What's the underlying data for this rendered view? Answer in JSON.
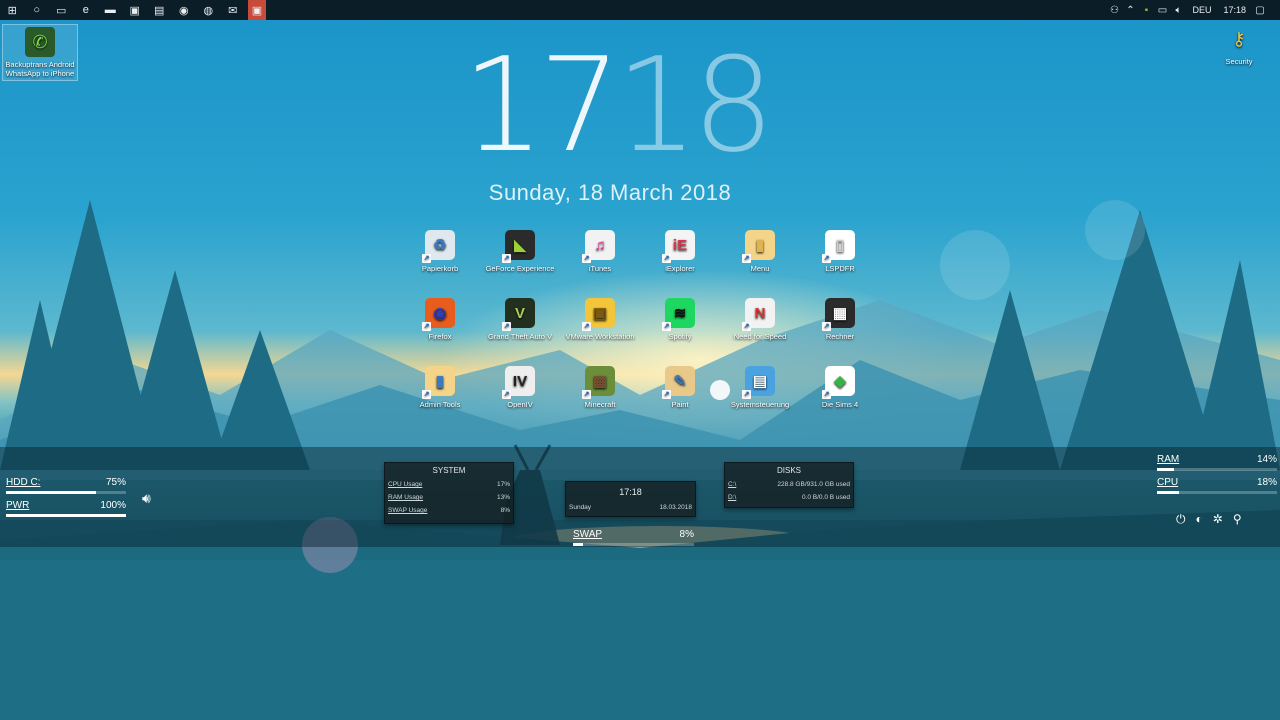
{
  "taskbar": {
    "left_icons": [
      {
        "name": "windows-start-icon",
        "glyph": "⊞"
      },
      {
        "name": "cortana-search-icon",
        "glyph": "○"
      },
      {
        "name": "task-view-icon",
        "glyph": "▭"
      },
      {
        "name": "edge-browser-icon",
        "glyph": "e"
      },
      {
        "name": "file-explorer-icon",
        "glyph": "▬"
      },
      {
        "name": "store-icon",
        "glyph": "▣"
      },
      {
        "name": "notepad-icon",
        "glyph": "▤"
      },
      {
        "name": "firefox-icon",
        "glyph": "◉"
      },
      {
        "name": "spotify-icon",
        "glyph": "◍"
      },
      {
        "name": "mail-icon",
        "glyph": "✉"
      },
      {
        "name": "active-app-icon",
        "glyph": "▣"
      }
    ],
    "tray": {
      "language": "DEU",
      "time": "17:18"
    }
  },
  "desktop": {
    "backup_icon_label": "Backuptrans Android WhatsApp to iPhone",
    "security_icon_label": "Security",
    "icons": [
      {
        "label": "Papierkorb",
        "glyph": "♻",
        "bg": "#dfe8ee",
        "fg": "#3a7bbf",
        "name": "recycle-bin-icon"
      },
      {
        "label": "GeForce Experience",
        "glyph": "◣",
        "bg": "#2b2b2b",
        "fg": "#9ecf3a",
        "name": "geforce-icon"
      },
      {
        "label": "iTunes",
        "glyph": "♫",
        "bg": "#f2f2f2",
        "fg": "#e0338f",
        "name": "itunes-icon"
      },
      {
        "label": "iExplorer",
        "glyph": "iE",
        "bg": "#f4f4f4",
        "fg": "#d7344e",
        "name": "iexplorer-icon"
      },
      {
        "label": "Menu",
        "glyph": "▮",
        "bg": "#f3d488",
        "fg": "#e0b34f",
        "name": "folder-icon"
      },
      {
        "label": "LSPDFR",
        "glyph": "▯",
        "bg": "#ffffff",
        "fg": "#cccccc",
        "name": "file-icon"
      },
      {
        "label": "Firefox",
        "glyph": "◉",
        "bg": "#e85c1e",
        "fg": "#2f3fb0",
        "name": "firefox-icon"
      },
      {
        "label": "Grand Theft Auto V",
        "glyph": "V",
        "bg": "#23301f",
        "fg": "#a8cf5a",
        "name": "gta-icon"
      },
      {
        "label": "VMware Workstation",
        "glyph": "▣",
        "bg": "#f2c53a",
        "fg": "#7a5a10",
        "name": "vmware-icon"
      },
      {
        "label": "Spotify",
        "glyph": "≋",
        "bg": "#1ed760",
        "fg": "#111111",
        "name": "spotify-icon"
      },
      {
        "label": "Need for Speed",
        "glyph": "N",
        "bg": "#f2f2f2",
        "fg": "#d8322f",
        "name": "nfs-icon"
      },
      {
        "label": "Rechner",
        "glyph": "▦",
        "bg": "#2b2b2b",
        "fg": "#ffffff",
        "name": "calculator-icon"
      },
      {
        "label": "Admin Tools",
        "glyph": "▮",
        "bg": "#f3d488",
        "fg": "#3a7bbf",
        "name": "admin-tools-icon"
      },
      {
        "label": "OpenIV",
        "glyph": "IV",
        "bg": "#eeeeee",
        "fg": "#222222",
        "name": "openiv-icon"
      },
      {
        "label": "Minecraft",
        "glyph": "▩",
        "bg": "#6b8e3a",
        "fg": "#7a5232",
        "name": "minecraft-icon"
      },
      {
        "label": "Paint",
        "glyph": "✎",
        "bg": "#e8c98a",
        "fg": "#3a7bbf",
        "name": "paint-icon"
      },
      {
        "label": "Systemsteuerung",
        "glyph": "▤",
        "bg": "#4aa2e0",
        "fg": "#ffffff",
        "name": "control-panel-icon"
      },
      {
        "label": "Die Sims 4",
        "glyph": "◆",
        "bg": "#ffffff",
        "fg": "#38b249",
        "name": "sims-icon"
      }
    ]
  },
  "clock": {
    "digits": [
      "1",
      "7",
      "1",
      "8"
    ],
    "date": "Sunday, 18  March  2018"
  },
  "hud": {
    "left_meters": [
      {
        "label": "HDD C:",
        "value": "75%",
        "fraction": 0.75
      },
      {
        "label": "PWR",
        "value": "100%",
        "fraction": 1.0
      }
    ],
    "right_meters": [
      {
        "label": "RAM",
        "value": "14%",
        "fraction": 0.14
      },
      {
        "label": "CPU",
        "value": "18%",
        "fraction": 0.18
      }
    ],
    "swap_meter": {
      "label": "SWAP",
      "value": "8%",
      "fraction": 0.08
    },
    "system_panel": {
      "title": "SYSTEM",
      "rows": [
        {
          "label": "CPU Usage",
          "value": "17%"
        },
        {
          "label": "RAM Usage",
          "value": "13%"
        },
        {
          "label": "SWAP Usage",
          "value": "8%"
        }
      ]
    },
    "time_panel": {
      "time": "17:18",
      "day": "Sunday",
      "date": "18.03.2018"
    },
    "disks_panel": {
      "title": "DISKS",
      "rows": [
        {
          "label": "C:\\",
          "value": "228.8 GB/931.0 GB used"
        },
        {
          "label": "D:\\",
          "value": "0.0 B/0.0 B used"
        }
      ]
    },
    "control_icons": [
      {
        "name": "power-icon",
        "glyph": "⏻"
      },
      {
        "name": "restart-icon",
        "glyph": "◐"
      },
      {
        "name": "settings-icon",
        "glyph": "✲"
      },
      {
        "name": "tools-icon",
        "glyph": "⚲"
      }
    ]
  }
}
